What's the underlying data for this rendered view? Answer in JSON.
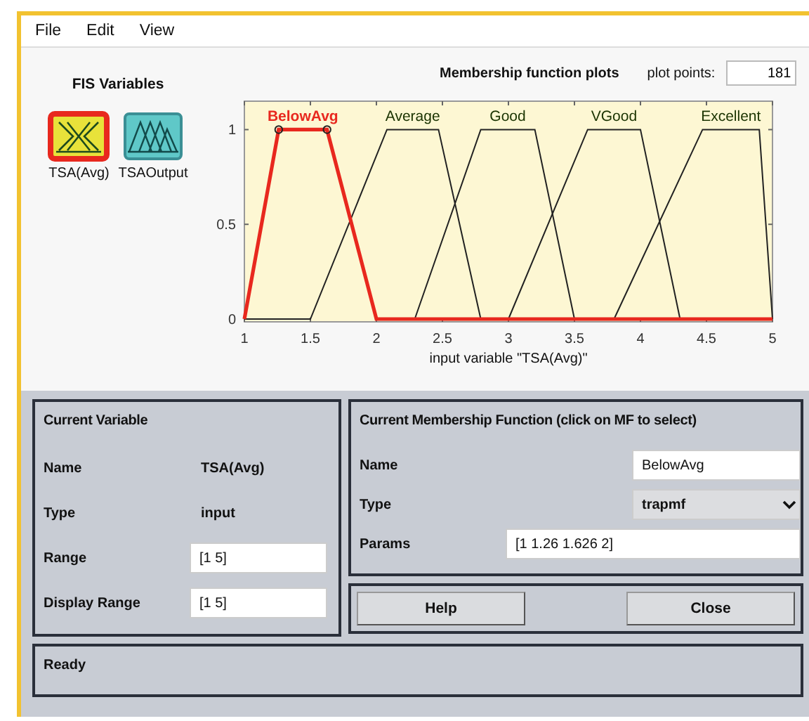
{
  "menu": [
    "File",
    "Edit",
    "View"
  ],
  "fis_variables": {
    "title": "FIS Variables",
    "variables": [
      {
        "name": "TSA(Avg)",
        "kind": "input",
        "selected": true
      },
      {
        "name": "TSAOutput",
        "kind": "output",
        "selected": false
      }
    ]
  },
  "plot": {
    "title": "Membership function plots",
    "plot_points_label": "plot points:",
    "plot_points": "181",
    "chart_data": {
      "type": "line",
      "xlabel": "input variable \"TSA(Avg)\"",
      "xlim": [
        1,
        5
      ],
      "ylim": [
        0,
        1.15
      ],
      "xticks": [
        1,
        1.5,
        2,
        2.5,
        3,
        3.5,
        4,
        4.5,
        5
      ],
      "yticks": [
        0,
        0.5,
        1
      ],
      "series": [
        {
          "name": "BelowAvg",
          "color": "#e8281e",
          "x": [
            1,
            1.26,
            1.626,
            2,
            5
          ],
          "values": [
            0,
            1,
            1,
            0,
            0
          ]
        },
        {
          "name": "Average",
          "color": "#222222",
          "x": [
            1,
            1.5,
            2.08,
            2.47,
            2.79
          ],
          "values": [
            0,
            0,
            1,
            1,
            0
          ]
        },
        {
          "name": "Good",
          "color": "#222222",
          "x": [
            2.29,
            2.79,
            3.2,
            3.5
          ],
          "values": [
            0,
            1,
            1,
            0
          ]
        },
        {
          "name": "VGood",
          "color": "#222222",
          "x": [
            3.0,
            3.6,
            4.0,
            4.3
          ],
          "values": [
            0,
            1,
            1,
            0
          ]
        },
        {
          "name": "Excellent",
          "color": "#222222",
          "x": [
            3.8,
            4.47,
            4.9,
            5
          ],
          "values": [
            0,
            1,
            1,
            0
          ]
        }
      ]
    }
  },
  "mf_states": [
    {
      "selected": true
    },
    {
      "selected": false
    },
    {
      "selected": false
    },
    {
      "selected": false
    },
    {
      "selected": false
    }
  ],
  "current_variable": {
    "title": "Current Variable",
    "fields": [
      {
        "label": "Name",
        "value": "TSA(Avg)",
        "kind": "text"
      },
      {
        "label": "Type",
        "value": "input",
        "kind": "text"
      },
      {
        "label": "Range",
        "value": "[1 5]",
        "kind": "input"
      },
      {
        "label": "Display Range",
        "value": "[1 5]",
        "kind": "input"
      }
    ]
  },
  "current_mf": {
    "title": "Current Membership Function (click on MF to select)",
    "fields": [
      {
        "label": "Name",
        "value": "BelowAvg",
        "kind": "input"
      },
      {
        "label": "Type",
        "value": "trapmf",
        "kind": "dropdown"
      },
      {
        "label": "Params",
        "value": "[1 1.26 1.626 2]",
        "kind": "wide-input"
      }
    ]
  },
  "buttons": [
    "Help",
    "Close"
  ],
  "status": "Ready"
}
